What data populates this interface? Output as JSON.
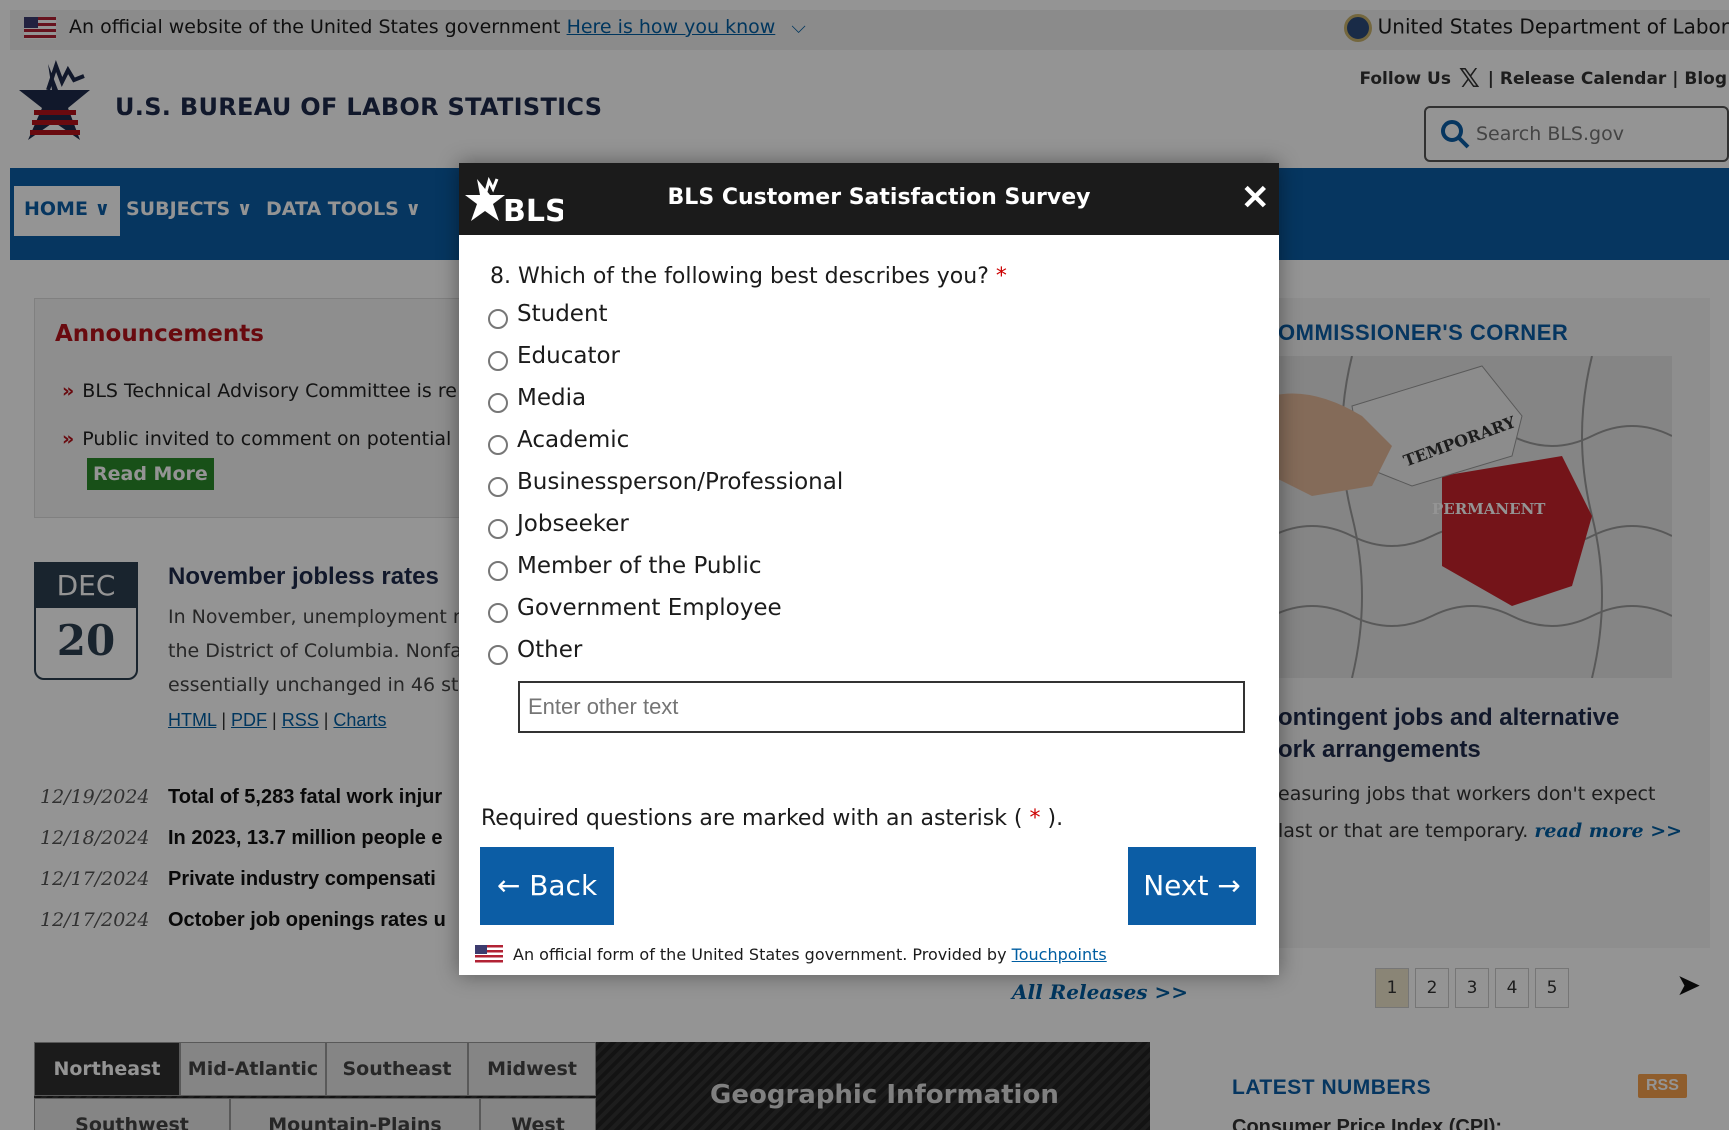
{
  "banner": {
    "text": "An official website of the United States government",
    "link": "Here is how you know",
    "department": "United States Department of Labor"
  },
  "header": {
    "title": "U.S. BUREAU OF LABOR STATISTICS",
    "follow": "Follow Us",
    "release_calendar": "| Release Calendar |",
    "blog": "Blog",
    "search_placeholder": "Search BLS.gov"
  },
  "nav": {
    "items": [
      {
        "label": "HOME"
      },
      {
        "label": "SUBJECTS"
      },
      {
        "label": "DATA TOOLS"
      }
    ]
  },
  "announcements": {
    "title": "Announcements",
    "items": [
      "BLS Technical Advisory Committee is re",
      "Public invited to comment on potential"
    ],
    "read_more": "Read More"
  },
  "news": {
    "month": "DEC",
    "day": "20",
    "title": "November jobless rates",
    "lines": [
      "In November, unemployment r",
      "the District of Columbia. Nonfa",
      "essentially unchanged in 46 sta"
    ],
    "links": [
      "HTML",
      "PDF",
      "RSS",
      "Charts"
    ]
  },
  "releases": [
    {
      "date": "12/19/2024",
      "title": "Total of 5,283 fatal work injur"
    },
    {
      "date": "12/18/2024",
      "title": "In 2023, 13.7 million people e"
    },
    {
      "date": "12/17/2024",
      "title": "Private industry compensati"
    },
    {
      "date": "12/17/2024",
      "title": "October job openings rates u"
    }
  ],
  "all_releases": "All Releases >>",
  "regions": {
    "row1": [
      "Northeast",
      "Mid-Atlantic",
      "Southeast",
      "Midwest"
    ],
    "row2": [
      "Southwest",
      "Mountain-Plains",
      "West"
    ],
    "geo_label": "Geographic Information"
  },
  "right": {
    "heading": "OMMISSIONER'S CORNER",
    "puzzle_top": "TEMPORARY",
    "puzzle_red": "PERMANENT",
    "title_lines": [
      "ontingent jobs and alternative",
      "ork arrangements"
    ],
    "desc_line1": "easuring jobs that workers don't expect",
    "desc_line2": "last or that are temporary.",
    "read_more": "read more >>",
    "pages": [
      "1",
      "2",
      "3",
      "4",
      "5"
    ],
    "latest": "LATEST NUMBERS",
    "rss": "RSS",
    "cpi": "Consumer Price Index (CPI):"
  },
  "modal": {
    "logo_text": "BLS",
    "title": "BLS Customer Satisfaction Survey",
    "close": "✕",
    "question": "8. Which of the following best describes you?",
    "asterisk": "*",
    "options": [
      "Student",
      "Educator",
      "Media",
      "Academic",
      "Businessperson/Professional",
      "Jobseeker",
      "Member of the Public",
      "Government Employee",
      "Other"
    ],
    "other_placeholder": "Enter other text",
    "required_note_pre": "Required questions are marked with an asterisk (",
    "required_note_post": ").",
    "back": "← Back",
    "next": "Next →",
    "footer_text": "An official form of the United States government. Provided by",
    "footer_link": "Touchpoints"
  },
  "colors": {
    "nav_blue": "#0c5da5",
    "bls_red": "#b5121b",
    "modal_header": "#1b1b1b"
  }
}
